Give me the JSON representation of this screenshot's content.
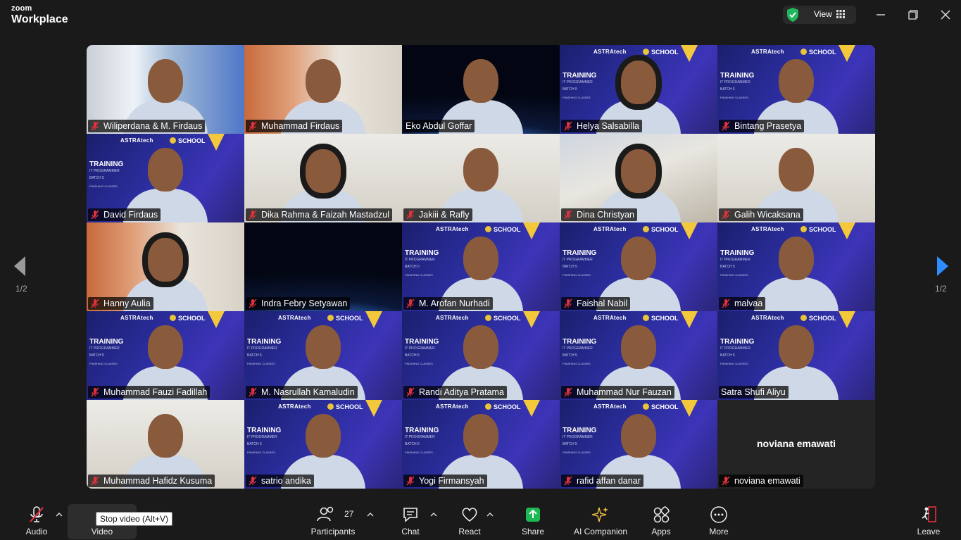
{
  "app": {
    "logo_small": "zoom",
    "logo_big": "Workplace",
    "view_label": "View"
  },
  "grid": {
    "tiles": [
      {
        "name": "Wiliperdana & M. Firdaus",
        "bg": "window"
      },
      {
        "name": "Muhammad Firdaus",
        "bg": "orange"
      },
      {
        "name": "Eko Abdul Goffar",
        "bg": "space",
        "active": true,
        "mic": "on"
      },
      {
        "name": "Helya Salsabilla",
        "bg": "astra"
      },
      {
        "name": "Bintang Prasetya",
        "bg": "astra"
      },
      {
        "name": "David Firdaus",
        "bg": "astra"
      },
      {
        "name": "Dika Rahma & Faizah Mastadzul",
        "bg": "wall"
      },
      {
        "name": "Jakiii & Rafly",
        "bg": "wall"
      },
      {
        "name": "Dina Christyan",
        "bg": "room"
      },
      {
        "name": "Galih Wicaksana",
        "bg": "wall"
      },
      {
        "name": "Hanny Aulia",
        "bg": "orange"
      },
      {
        "name": "Indra Febry Setyawan",
        "bg": "space",
        "no_person": true
      },
      {
        "name": "M. Arofan Nurhadi",
        "bg": "astra"
      },
      {
        "name": "Faishal Nabil",
        "bg": "astra"
      },
      {
        "name": "malvaa",
        "bg": "astra"
      },
      {
        "name": "Muhammad Fauzi Fadillah",
        "bg": "astra"
      },
      {
        "name": "M. Nasrullah Kamaludin",
        "bg": "astra"
      },
      {
        "name": "Randi Aditya Pratama",
        "bg": "astra"
      },
      {
        "name": "Muhammad Nur Fauzan",
        "bg": "astra"
      },
      {
        "name": "Satra Shufi Aliyu",
        "bg": "astra",
        "mic": "on"
      },
      {
        "name": "Muhammad Hafidz Kusuma",
        "bg": "wall"
      },
      {
        "name": "satrio andika",
        "bg": "astra"
      },
      {
        "name": "Yogi Firmansyah",
        "bg": "astra"
      },
      {
        "name": "rafid affan danar",
        "bg": "astra"
      },
      {
        "name": "noviana emawati",
        "bg": "dark",
        "no_person": true,
        "center_name": "noviana emawati"
      }
    ],
    "astra_text": {
      "astra": "ASTRAtech",
      "school": "SCHOOL",
      "training": "TRAINING",
      "program": "IT PROGRAMMER",
      "batch": "BATCH 5",
      "mode": "FINISHING CLASSES"
    }
  },
  "pagination": {
    "left": "1/2",
    "right": "1/2"
  },
  "toolbar": {
    "audio": "Audio",
    "video": "Video",
    "tooltip": "Stop video (Alt+V)",
    "participants": "Participants",
    "participant_count": "27",
    "chat": "Chat",
    "react": "React",
    "share": "Share",
    "ai_companion": "AI Companion",
    "apps": "Apps",
    "more": "More",
    "leave": "Leave"
  },
  "colors": {
    "active_border": "#2fd27a",
    "share_green": "#1db954",
    "mic_off_red": "#e0323c",
    "ai_yellow": "#f5c542"
  }
}
